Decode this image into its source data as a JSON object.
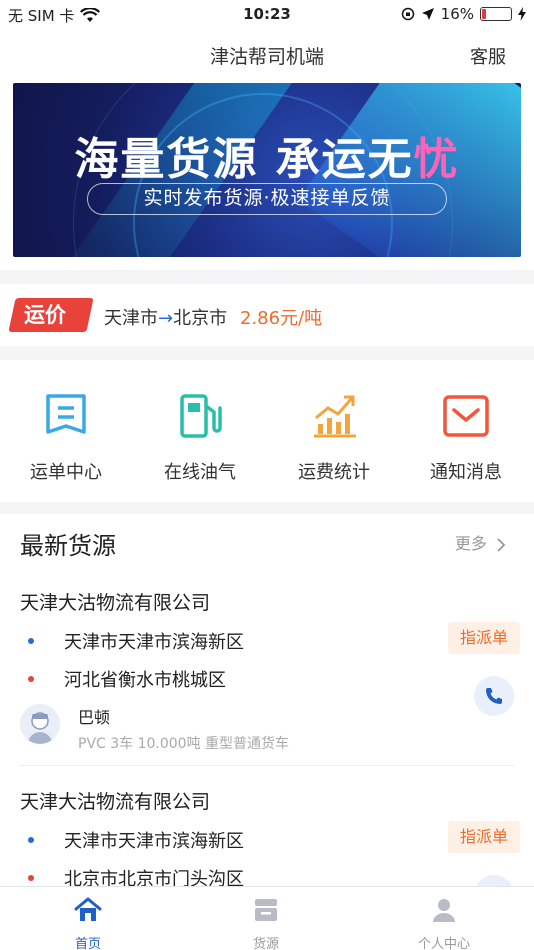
{
  "status_bar": {
    "carrier": "无 SIM 卡",
    "time": "10:23",
    "battery_text": "16%",
    "battery_level": 0.16
  },
  "navbar": {
    "title": "津沽帮司机端",
    "service": "客服"
  },
  "banner": {
    "headline_part1": "海量货源",
    "headline_part2": "承运无",
    "headline_part3": "忧",
    "subtitle": "实时发布货源·极速接单反馈"
  },
  "freight": {
    "tag": "运价",
    "from": "天津市",
    "arrow": "→",
    "to": "北京市",
    "price": "2.86元/吨"
  },
  "menu": {
    "items": [
      {
        "label": "运单中心",
        "icon": "waybill-icon",
        "color": "#3aa8e8"
      },
      {
        "label": "在线油气",
        "icon": "gas-pump-icon",
        "color": "#27bfa8"
      },
      {
        "label": "运费统计",
        "icon": "chart-icon",
        "color": "#f3a43a"
      },
      {
        "label": "通知消息",
        "icon": "mail-icon",
        "color": "#f0573c"
      }
    ]
  },
  "goods": {
    "title": "最新货源",
    "more": "更多",
    "cards": [
      {
        "company": "天津大沽物流有限公司",
        "origin": "天津市天津市滨海新区",
        "destination": "河北省衡水市桃城区",
        "badge": "指派单",
        "contact": "巴顿",
        "desc": "PVC 3车 10.000吨 重型普通货车"
      },
      {
        "company": "天津大沽物流有限公司",
        "origin": "天津市天津市滨海新区",
        "destination": "北京市北京市门头沟区",
        "badge": "指派单"
      }
    ]
  },
  "tabbar": {
    "tabs": [
      {
        "label": "首页",
        "icon": "home-icon",
        "active": true
      },
      {
        "label": "货源",
        "icon": "cargo-icon",
        "active": false
      },
      {
        "label": "个人中心",
        "icon": "user-icon",
        "active": false
      }
    ]
  },
  "colors": {
    "primary": "#1f5fc8",
    "accent_orange": "#f06a2c",
    "tag_red": "#e8423b"
  }
}
